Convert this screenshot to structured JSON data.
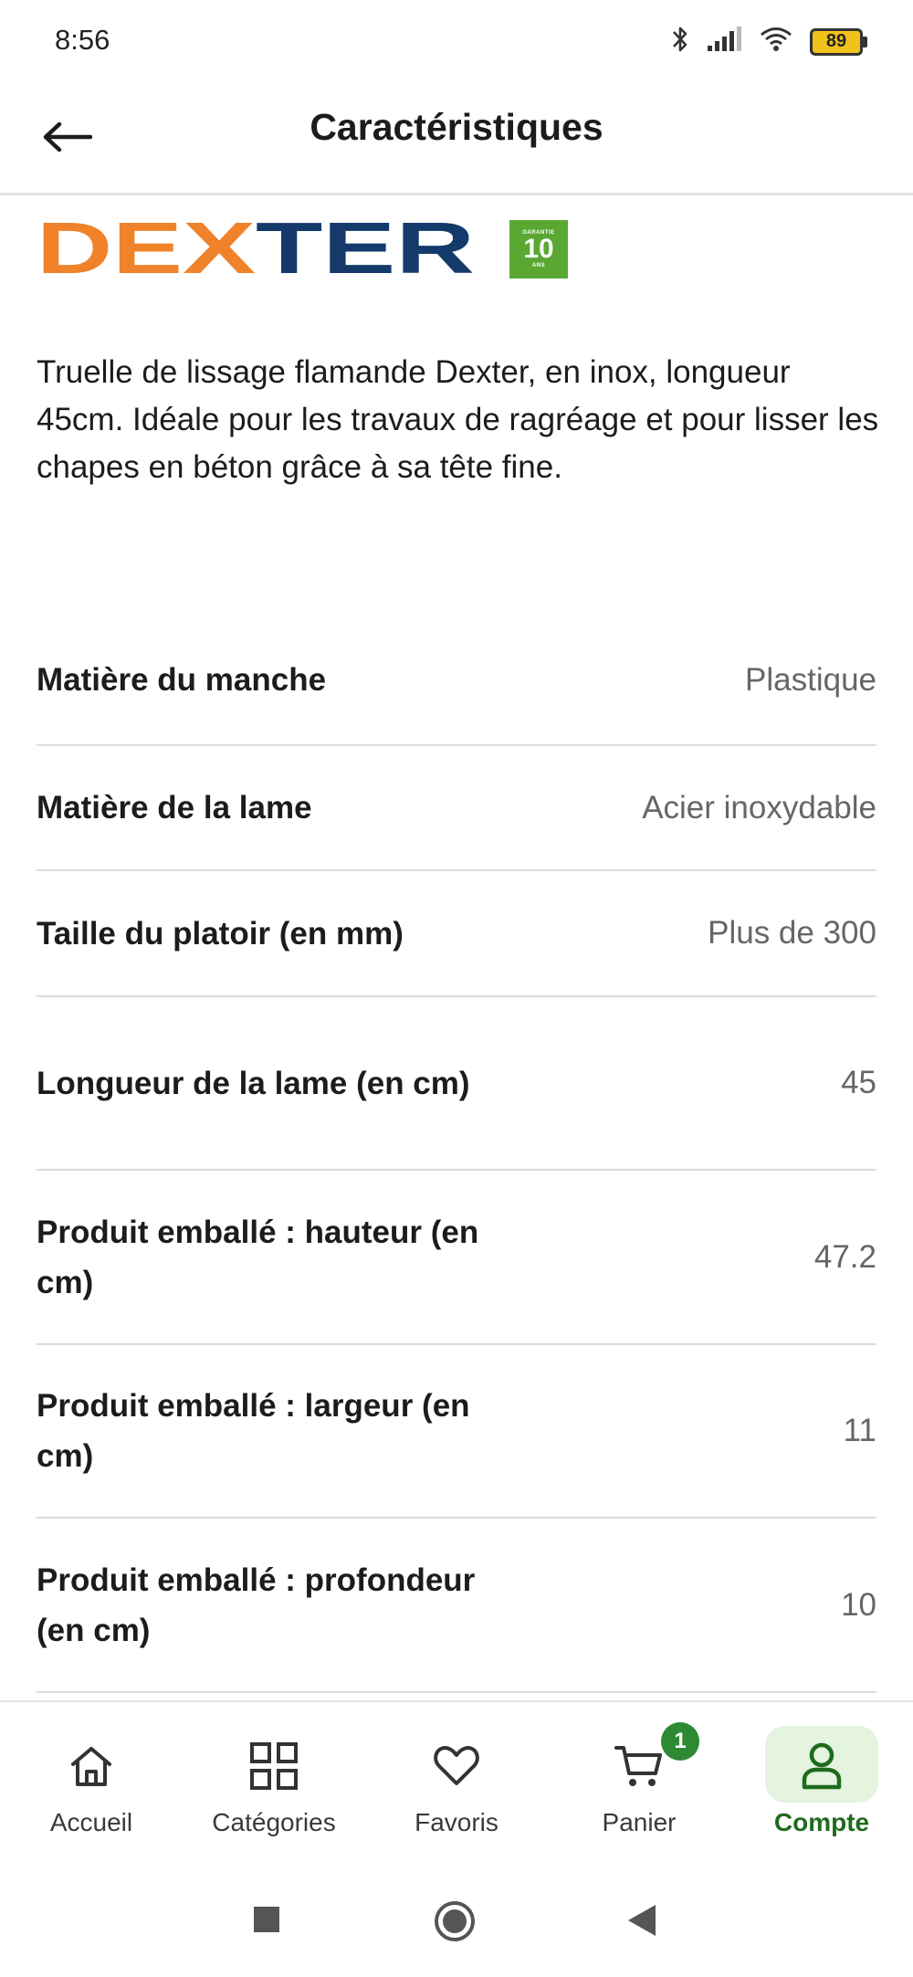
{
  "status_bar": {
    "time": "8:56",
    "battery": "89",
    "icons": [
      "bluetooth-icon",
      "signal-icon",
      "wifi-icon",
      "battery-icon"
    ]
  },
  "header": {
    "title": "Caractéristiques",
    "back_icon": "arrow-left-icon"
  },
  "brand": {
    "name": "DEXTER",
    "warranty_small": "GARANTIE",
    "warranty_years": "10",
    "warranty_unit": "ANS",
    "colors": {
      "orange": "#f0822a",
      "navy": "#143a6b",
      "green": "#5aa832"
    }
  },
  "description": "Truelle de lissage flamande Dexter, en inox, longueur 45cm. Idéale pour les travaux de ragréage et pour lisser les chapes en béton grâce à sa tête fine.",
  "specs": [
    {
      "label": "Matière du manche",
      "value": "Plastique"
    },
    {
      "label": "Matière de la lame",
      "value": "Acier inoxydable"
    },
    {
      "label": "Taille du platoir (en mm)",
      "value": "Plus de 300"
    },
    {
      "label": "Longueur de la lame (en cm)",
      "value": "45"
    },
    {
      "label": "Produit emballé : hauteur (en cm)",
      "value": "47.2"
    },
    {
      "label": "Produit emballé : largeur (en cm)",
      "value": "11"
    },
    {
      "label": "Produit emballé : profondeur (en cm)",
      "value": "10"
    }
  ],
  "bottom_nav": {
    "items": [
      {
        "label": "Accueil",
        "icon": "home-icon"
      },
      {
        "label": "Catégories",
        "icon": "grid-icon"
      },
      {
        "label": "Favoris",
        "icon": "heart-icon"
      },
      {
        "label": "Panier",
        "icon": "cart-icon",
        "badge": "1"
      },
      {
        "label": "Compte",
        "icon": "user-icon",
        "active": true
      }
    ],
    "active_color": "#1e6b1e"
  },
  "system_nav": [
    "recents-square-icon",
    "home-circle-icon",
    "back-triangle-icon"
  ]
}
